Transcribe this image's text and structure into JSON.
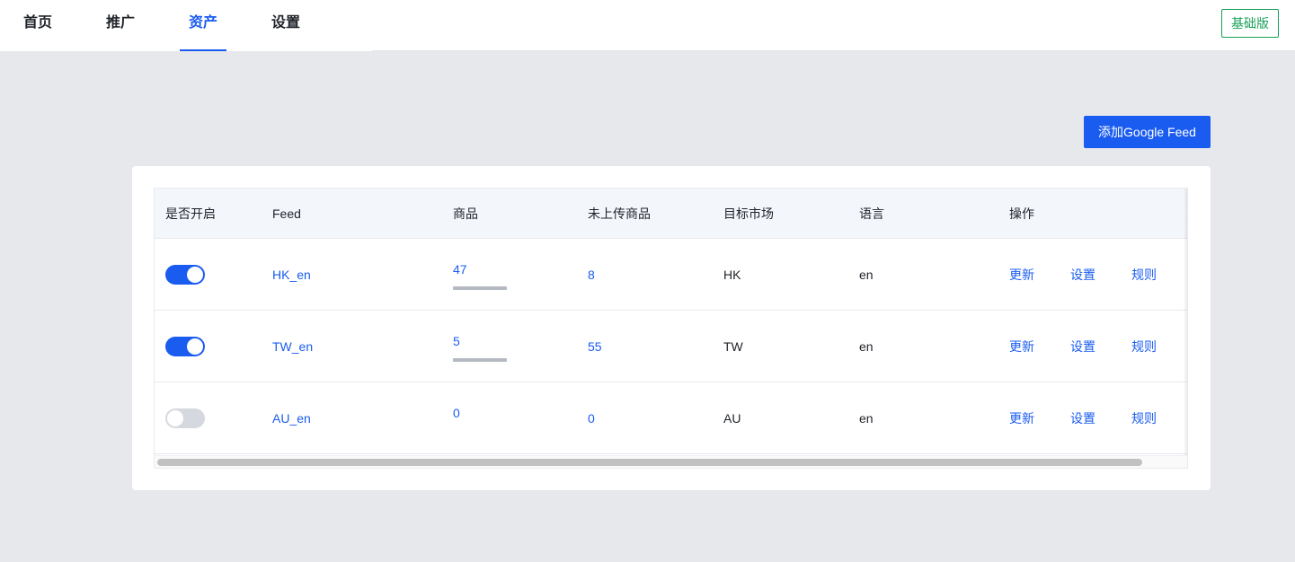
{
  "nav": {
    "tabs": [
      {
        "label": "首页"
      },
      {
        "label": "推广"
      },
      {
        "label": "资产"
      },
      {
        "label": "设置"
      }
    ],
    "active_tab": "资产",
    "plan_badge": "基础版"
  },
  "toolbar": {
    "add_feed_label": "添加Google Feed"
  },
  "table": {
    "columns": [
      "是否开启",
      "Feed",
      "商品",
      "未上传商品",
      "目标市场",
      "语言",
      "操作"
    ],
    "rows": [
      {
        "enabled": true,
        "feed": "HK_en",
        "goods": "47",
        "not_uploaded": "8",
        "market": "HK",
        "language": "en",
        "action_update": "更新",
        "action_settings": "设置",
        "action_rules": "规则"
      },
      {
        "enabled": true,
        "feed": "TW_en",
        "goods": "5",
        "not_uploaded": "55",
        "market": "TW",
        "language": "en",
        "action_update": "更新",
        "action_settings": "设置",
        "action_rules": "规则"
      },
      {
        "enabled": false,
        "feed": "AU_en",
        "goods": "0",
        "not_uploaded": "0",
        "market": "AU",
        "language": "en",
        "action_update": "更新",
        "action_settings": "设置",
        "action_rules": "规则"
      }
    ]
  },
  "colors": {
    "accent": "#1a5cf0",
    "plan_badge": "#18a058",
    "background": "#e6e8ec"
  }
}
